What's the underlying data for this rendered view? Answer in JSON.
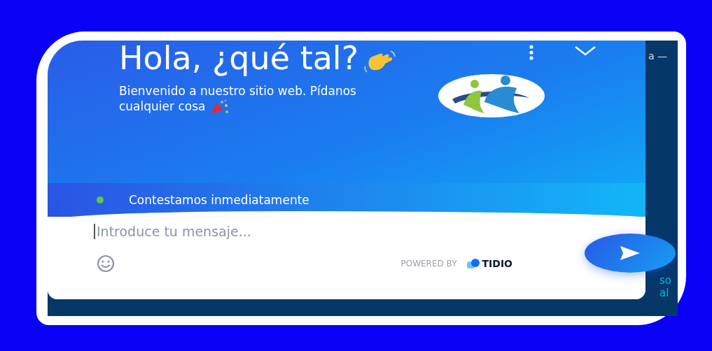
{
  "header": {
    "title": "Hola, ¿qué tal?",
    "subtitle": "Bienvenido a nuestro sitio web. Pídanos cualquier cosa"
  },
  "status": {
    "text": "Contestamos inmediatamente",
    "online": true
  },
  "composer": {
    "placeholder": "Introduce tu mensaje..."
  },
  "branding": {
    "prefix": "POWERED BY",
    "brand": "TIDIO"
  },
  "background_text": [
    "a —",
    "so",
    "al"
  ]
}
